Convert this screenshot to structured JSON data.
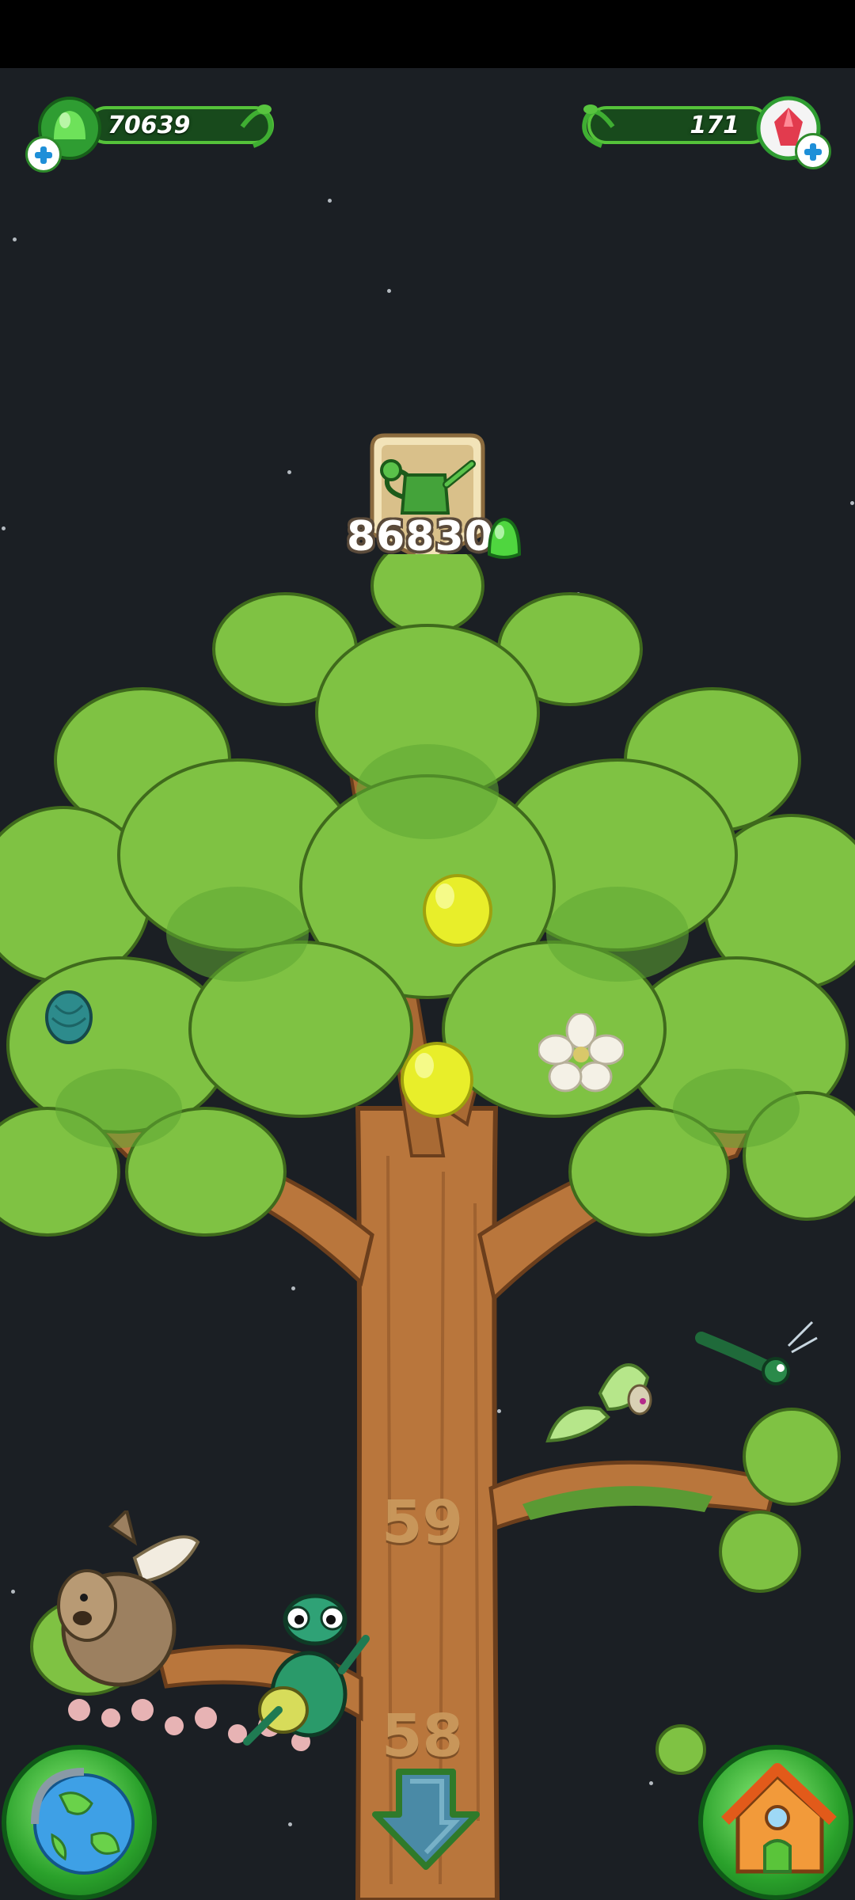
{
  "hud": {
    "gems": {
      "value": "70639",
      "icon": "green-gem-icon"
    },
    "crystals": {
      "value": "171",
      "icon": "red-crystal-icon"
    }
  },
  "upgrade": {
    "cost": "86830",
    "icon": "watering-can-icon",
    "currency_icon": "green-gem-icon"
  },
  "tree": {
    "level_upper": "59",
    "level_lower": "58"
  },
  "nav": {
    "world_icon": "globe-icon",
    "home_icon": "house-icon",
    "down_icon": "down-arrow-icon"
  },
  "colors": {
    "background": "#1b1f24",
    "accent": "#55c23a",
    "trunk": "#b9763c",
    "leaves": "#7fc243"
  }
}
